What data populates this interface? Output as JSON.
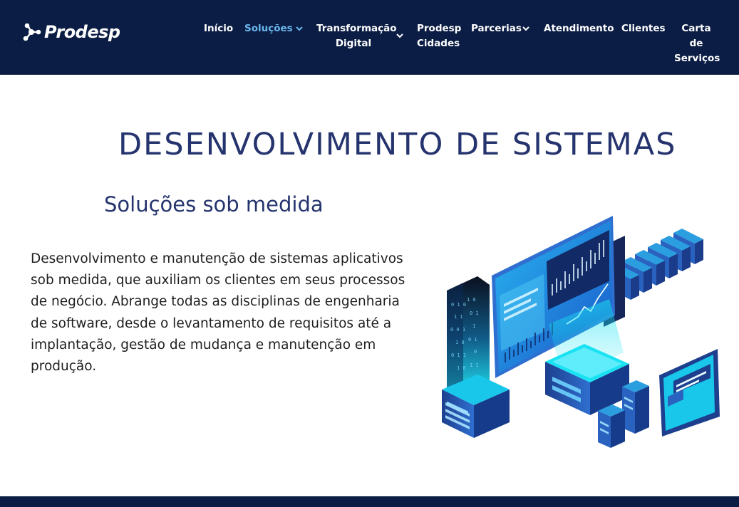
{
  "header": {
    "logo_text": "Prodesp",
    "nav": [
      {
        "label_line1": "Início",
        "label_line2": "",
        "has_dropdown": false,
        "active": false
      },
      {
        "label_line1": "Soluções",
        "label_line2": "",
        "has_dropdown": true,
        "active": true
      },
      {
        "label_line1": "Transformação",
        "label_line2": "Digital",
        "has_dropdown": true,
        "active": false
      },
      {
        "label_line1": "Prodesp",
        "label_line2": "Cidades",
        "has_dropdown": false,
        "active": false
      },
      {
        "label_line1": "Parcerias",
        "label_line2": "",
        "has_dropdown": true,
        "active": false
      },
      {
        "label_line1": "Atendimento",
        "label_line2": "",
        "has_dropdown": false,
        "active": false
      },
      {
        "label_line1": "Clientes",
        "label_line2": "",
        "has_dropdown": false,
        "active": false
      },
      {
        "label_line1": "Carta de",
        "label_line2": "Serviços",
        "has_dropdown": false,
        "active": false
      }
    ]
  },
  "main": {
    "title": "DESENVOLVIMENTO DE SISTEMAS",
    "subtitle": "Soluções sob medida",
    "description": "Desenvolvimento e manutenção de sistemas aplicativos sob medida, que auxiliam os clientes em seus processos de negócio. Abrange todas as disciplinas de engenharia de software, desde o levantamento de requisitos até a implantação, gestão de mudança e manutenção em produção."
  },
  "colors": {
    "header_bg": "#0b1d44",
    "nav_active": "#6ab8ee",
    "title": "#25346e",
    "accent_cyan": "#19e3f2",
    "illustration_dark": "#1d3f8e"
  },
  "icons": {
    "logo": "prodesp-molecule-logo-icon",
    "dropdown": "chevron-down-icon",
    "illustration": "isometric-data-center-illustration"
  }
}
